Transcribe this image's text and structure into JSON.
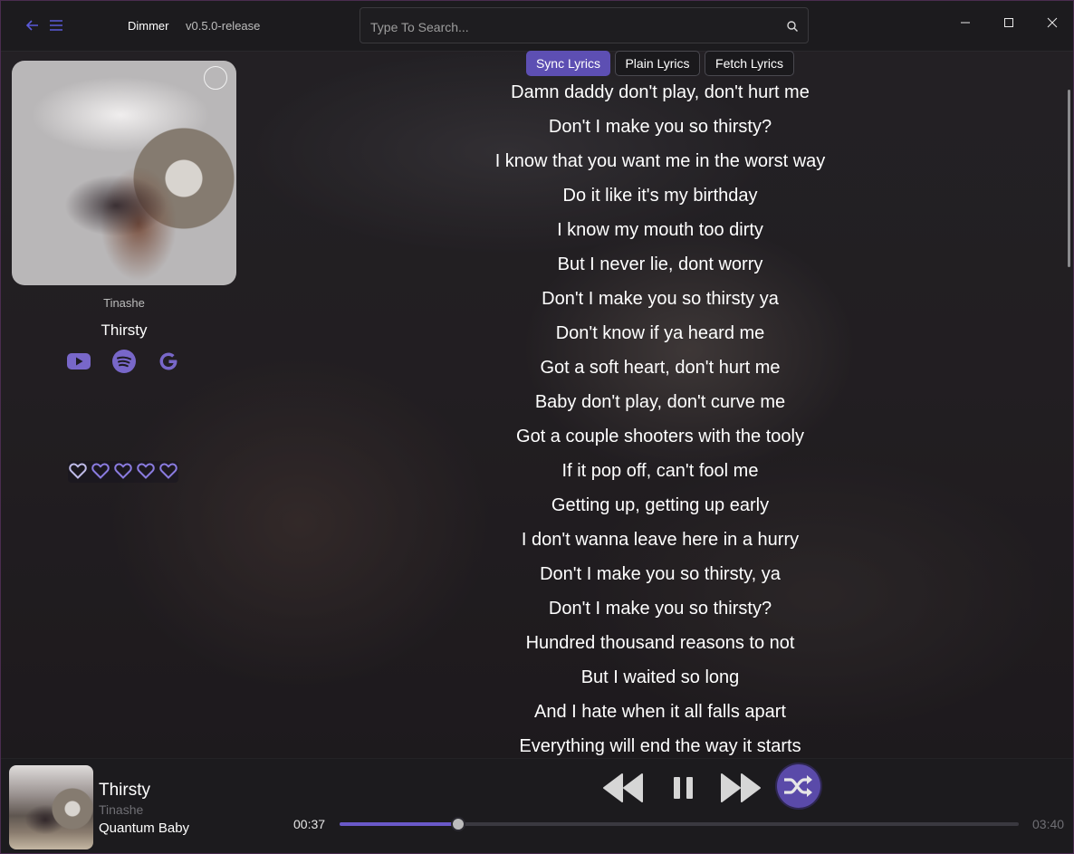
{
  "app": {
    "name": "Dimmer",
    "version": "v0.5.0-release"
  },
  "search": {
    "placeholder": "Type To Search..."
  },
  "colors": {
    "accent": "#5d4fb3",
    "heart": "#8a7be0",
    "social": "#7867c9"
  },
  "sidebar": {
    "artist": "Tinashe",
    "title": "Thirsty",
    "links": [
      "youtube-icon",
      "spotify-icon",
      "google-icon"
    ],
    "rating": {
      "max": 5,
      "value": 0
    }
  },
  "lyrics_tabs": [
    {
      "label": "Sync Lyrics",
      "active": true
    },
    {
      "label": "Plain Lyrics",
      "active": false
    },
    {
      "label": "Fetch Lyrics",
      "active": false
    }
  ],
  "lyrics": [
    "Damn daddy don't play, don't hurt me",
    "Don't I make you so thirsty?",
    "I know that you want me in the worst way",
    "Do it like it's my birthday",
    "I know my mouth too dirty",
    "But I never lie, dont worry",
    "Don't I make you so thirsty ya",
    "Don't know if ya heard me",
    "Got a soft heart, don't hurt me",
    "Baby don't play, don't curve me",
    "Got a couple shooters with the tooly",
    "If it pop off, can't fool me",
    "Getting up, getting up early",
    "I don't wanna leave here in a hurry",
    "Don't I make you so thirsty, ya",
    "Don't I make you so thirsty?",
    "Hundred thousand reasons to not",
    "But I waited so long",
    "And I hate when it all falls apart",
    "Everything will end the way it starts"
  ],
  "player": {
    "title": "Thirsty",
    "artist": "Tinashe",
    "album": "Quantum Baby",
    "current_time": "00:37",
    "total_time": "03:40",
    "progress": 0.175,
    "shuffle": true,
    "controls": [
      "previous-icon",
      "pause-icon",
      "next-icon",
      "shuffle-icon"
    ]
  }
}
